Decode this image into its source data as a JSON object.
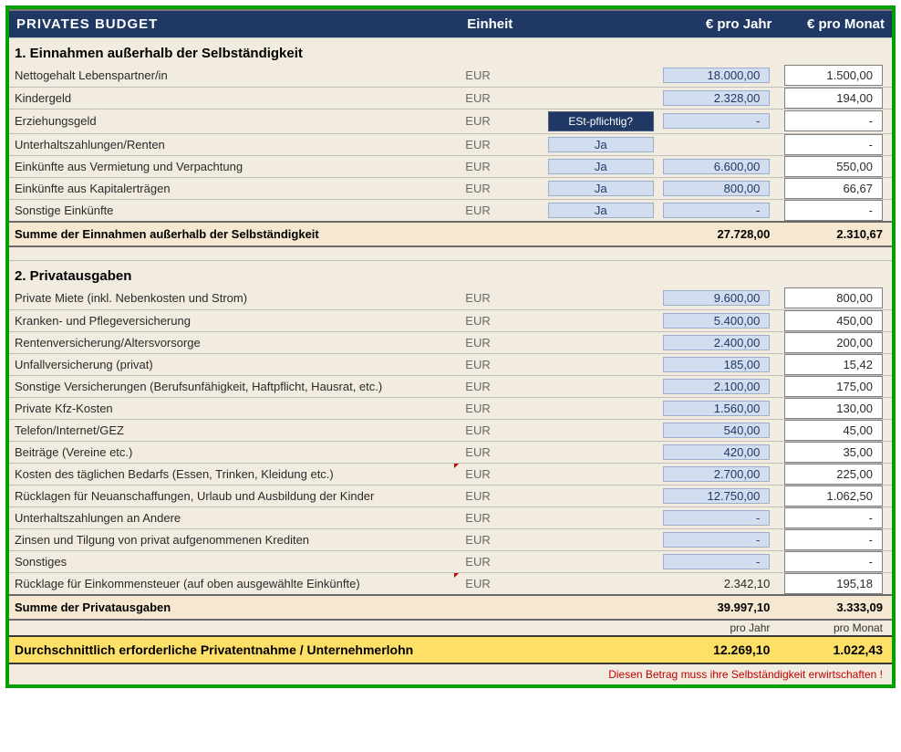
{
  "header": {
    "title": "PRIVATES  BUDGET",
    "unit": "Einheit",
    "year": "€ pro Jahr",
    "month": "€ pro Monat"
  },
  "sections": {
    "income": {
      "heading": "1. Einnahmen außerhalb der Selbständigkeit",
      "sum_label": "Summe der Einnahmen außerhalb der Selbständigkeit",
      "sum_year": "27.728,00",
      "sum_month": "2.310,67",
      "tax_header": "ESt-pflichtig?",
      "rows": [
        {
          "label": "Nettogehalt Lebenspartner/in",
          "unit": "EUR",
          "tax": "",
          "year": "18.000,00",
          "month": "1.500,00"
        },
        {
          "label": "Kindergeld",
          "unit": "EUR",
          "tax": "",
          "year": "2.328,00",
          "month": "194,00"
        },
        {
          "label": "Erziehungsgeld",
          "unit": "EUR",
          "tax": "HEADER",
          "year": "-",
          "month": "-"
        },
        {
          "label": "Unterhaltszahlungen/Renten",
          "unit": "EUR",
          "tax": "Ja",
          "year": "",
          "month": "-"
        },
        {
          "label": "Einkünfte aus Vermietung und Verpachtung",
          "unit": "EUR",
          "tax": "Ja",
          "year": "6.600,00",
          "month": "550,00"
        },
        {
          "label": "Einkünfte aus Kapitalerträgen",
          "unit": "EUR",
          "tax": "Ja",
          "year": "800,00",
          "month": "66,67"
        },
        {
          "label": "Sonstige Einkünfte",
          "unit": "EUR",
          "tax": "Ja",
          "year": "-",
          "month": "-"
        }
      ]
    },
    "expenses": {
      "heading": "2. Privatausgaben",
      "sum_label": "Summe der Privatausgaben",
      "sum_year": "39.997,10",
      "sum_month": "3.333,09",
      "rows": [
        {
          "label": "Private Miete (inkl. Nebenkosten und Strom)",
          "unit": "EUR",
          "year": "9.600,00",
          "month": "800,00"
        },
        {
          "label": "Kranken- und Pflegeversicherung",
          "unit": "EUR",
          "year": "5.400,00",
          "month": "450,00"
        },
        {
          "label": "Rentenversicherung/Altersvorsorge",
          "unit": "EUR",
          "year": "2.400,00",
          "month": "200,00"
        },
        {
          "label": "Unfallversicherung (privat)",
          "unit": "EUR",
          "year": "185,00",
          "month": "15,42"
        },
        {
          "label": "Sonstige Versicherungen (Berufsunfähigkeit, Haftpflicht, Hausrat, etc.)",
          "unit": "EUR",
          "year": "2.100,00",
          "month": "175,00"
        },
        {
          "label": "Private Kfz-Kosten",
          "unit": "EUR",
          "year": "1.560,00",
          "month": "130,00"
        },
        {
          "label": "Telefon/Internet/GEZ",
          "unit": "EUR",
          "year": "540,00",
          "month": "45,00"
        },
        {
          "label": "Beiträge (Vereine etc.)",
          "unit": "EUR",
          "year": "420,00",
          "month": "35,00"
        },
        {
          "label": "Kosten des täglichen Bedarfs (Essen, Trinken, Kleidung etc.)",
          "unit": "EUR",
          "year": "2.700,00",
          "month": "225,00",
          "tick": true
        },
        {
          "label": "Rücklagen für Neuanschaffungen, Urlaub und Ausbildung der Kinder",
          "unit": "EUR",
          "year": "12.750,00",
          "month": "1.062,50"
        },
        {
          "label": "Unterhaltszahlungen an Andere",
          "unit": "EUR",
          "year": "-",
          "month": "-"
        },
        {
          "label": "Zinsen und Tilgung von privat aufgenommenen Krediten",
          "unit": "EUR",
          "year": "-",
          "month": "-"
        },
        {
          "label": "Sonstiges",
          "unit": "EUR",
          "year": "-",
          "month": "-"
        },
        {
          "label": "Rücklage für Einkommensteuer (auf oben ausgewählte Einkünfte)",
          "unit": "EUR",
          "year": "2.342,10",
          "month": "195,18",
          "tick": true,
          "readonly": true
        }
      ]
    }
  },
  "prelabel": {
    "year": "pro Jahr",
    "month": "pro Monat"
  },
  "final": {
    "label": "Durchschnittlich erforderliche Privatentnahme / Unternehmerlohn",
    "year": "12.269,10",
    "month": "1.022,43"
  },
  "footer_note": "Diesen Betrag muss ihre Selbständigkeit erwirtschaften !"
}
